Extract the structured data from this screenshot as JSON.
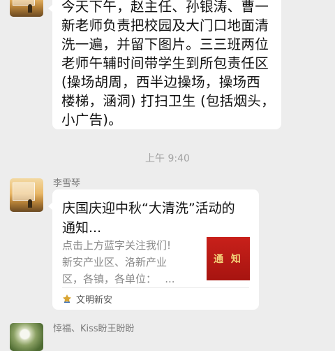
{
  "messages": [
    {
      "text": "今天下午，赵主任、孙银涛、曹一\n新老师负责把校园及大门口地面清\n洗一遍，并留下图片。三三班两位\n老师午辅时间带学生到所包责任区\n(操场胡周，西半边操场，操场西\n楼梯，涵洞) 打扫卫生 (包括烟头，\n小广告)。"
    }
  ],
  "timestamp": "上午 9:40",
  "link_message": {
    "sender": "李雪琴",
    "card": {
      "title": "庆国庆迎中秋“大清洗”活动的\n通知...",
      "description": "点击上方蓝字关注我们!\n新安产业区、洛新产业\n区，各镇，各单位：　 ...",
      "thumbnail_text": "通 知",
      "source": "文明新安"
    }
  },
  "next_message": {
    "sender": "悻福、Kiss盼王盼盼"
  }
}
